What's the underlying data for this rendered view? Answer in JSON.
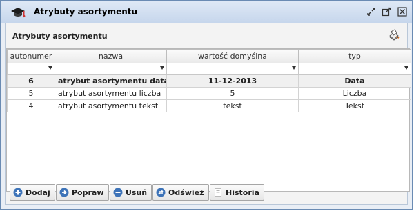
{
  "window": {
    "title": "Atrybuty asortymentu"
  },
  "panel": {
    "title": "Atrybuty asortymentu"
  },
  "table": {
    "columns": [
      "autonumer",
      "nazwa",
      "wartość domyślna",
      "typ"
    ],
    "rows": [
      [
        "6",
        "atrybut asortymentu data",
        "11-12-2013",
        "Data"
      ],
      [
        "5",
        "atrybut asortymentu liczba",
        "5",
        "Liczba"
      ],
      [
        "4",
        "atrybut asortymentu tekst",
        "tekst",
        "Tekst"
      ]
    ],
    "selected_row_index": 0
  },
  "buttons": {
    "add": "Dodaj",
    "edit": "Popraw",
    "delete": "Usuń",
    "refresh": "Odśwież",
    "history": "Historia"
  },
  "colors": {
    "accent": "#3d73b8",
    "border": "#6a8bb3"
  },
  "icons": {
    "app": "graduation-cap-icon",
    "restore": "restore-icon",
    "maximize": "maximize-icon",
    "close": "close-icon",
    "panel": "print-icon",
    "add": "plus-circle-icon",
    "edit": "arrow-circle-icon",
    "delete": "minus-circle-icon",
    "refresh": "refresh-icon",
    "history": "document-icon"
  }
}
